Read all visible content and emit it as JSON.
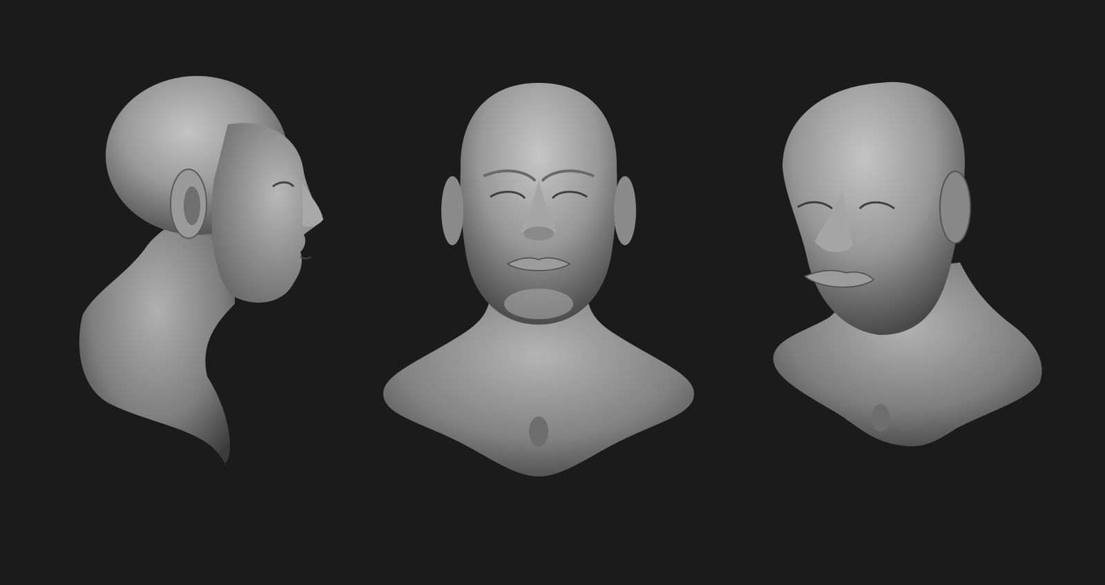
{
  "scene": {
    "background_color": "#1b1b1b",
    "material_color": "#8c8c8c",
    "highlight_color": "#c9c9c9",
    "shadow_color": "#3a3a3a",
    "views": [
      {
        "id": "side",
        "description_name": "side-profile-head-sculpt"
      },
      {
        "id": "front",
        "description_name": "front-head-sculpt"
      },
      {
        "id": "three-quarter",
        "description_name": "three-quarter-head-sculpt"
      }
    ]
  }
}
